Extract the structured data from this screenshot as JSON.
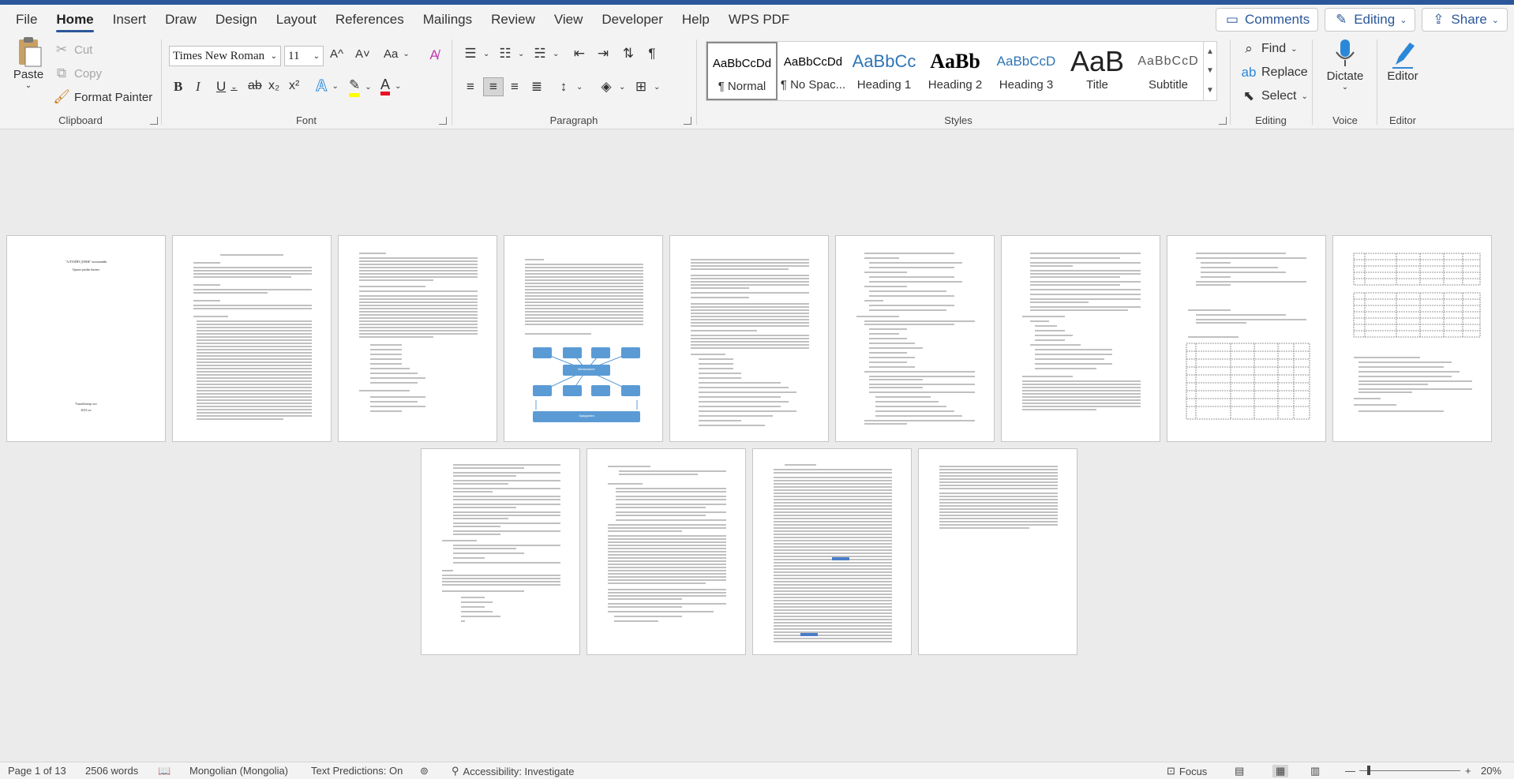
{
  "menu": {
    "tabs": [
      "File",
      "Home",
      "Insert",
      "Draw",
      "Design",
      "Layout",
      "References",
      "Mailings",
      "Review",
      "View",
      "Developer",
      "Help",
      "WPS PDF"
    ],
    "active_tab": "Home",
    "comments_label": "Comments",
    "editing_label": "Editing",
    "share_label": "Share"
  },
  "clipboard": {
    "group_label": "Clipboard",
    "paste_label": "Paste",
    "cut_label": "Cut",
    "copy_label": "Copy",
    "format_painter_label": "Format Painter"
  },
  "font": {
    "group_label": "Font",
    "font_name": "Times New Roman",
    "font_size": "11",
    "bold": "B",
    "italic": "I",
    "underline": "U",
    "subscript": "x₂",
    "superscript": "x²",
    "grow": "A^",
    "shrink": "A˅",
    "change_case": "Aa",
    "font_color_hex": "#e81123",
    "highlight_hex": "#ffff00"
  },
  "paragraph": {
    "group_label": "Paragraph"
  },
  "styles": {
    "group_label": "Styles",
    "items": [
      {
        "preview": "AaBbCcDd",
        "name": "¶ Normal"
      },
      {
        "preview": "AaBbCcDd",
        "name": "¶ No Spac..."
      },
      {
        "preview": "AaBbCc",
        "name": "Heading 1"
      },
      {
        "preview": "AaBb",
        "name": "Heading 2"
      },
      {
        "preview": "AaBbCcD",
        "name": "Heading 3"
      },
      {
        "preview": "AaB",
        "name": "Title"
      },
      {
        "preview": "AaBbCcD",
        "name": "Subtitle"
      }
    ]
  },
  "editing": {
    "group_label": "Editing",
    "find_label": "Find",
    "replace_label": "Replace",
    "select_label": "Select"
  },
  "voice": {
    "group_label": "Voice",
    "dictate_label": "Dictate"
  },
  "editor": {
    "group_label": "Editor",
    "editor_label": "Editor"
  },
  "document": {
    "cover_title": "\"АЛТАЙН ДЭНЖ\" компанийн",
    "cover_subtitle": "Орчин үеийн бизнес",
    "cover_footer": "Улаанбаатар хот",
    "cover_year": "2023 он",
    "diagram_center": "Менежмент",
    "diagram_bottom": "Удирдлага"
  },
  "status": {
    "page": "Page 1 of 13",
    "words": "2506 words",
    "language": "Mongolian (Mongolia)",
    "predictions": "Text Predictions: On",
    "accessibility": "Accessibility: Investigate",
    "focus": "Focus",
    "zoom": "20%"
  },
  "colors": {
    "brand": "#2b579a",
    "diagram_blue": "#5b9bd5"
  }
}
